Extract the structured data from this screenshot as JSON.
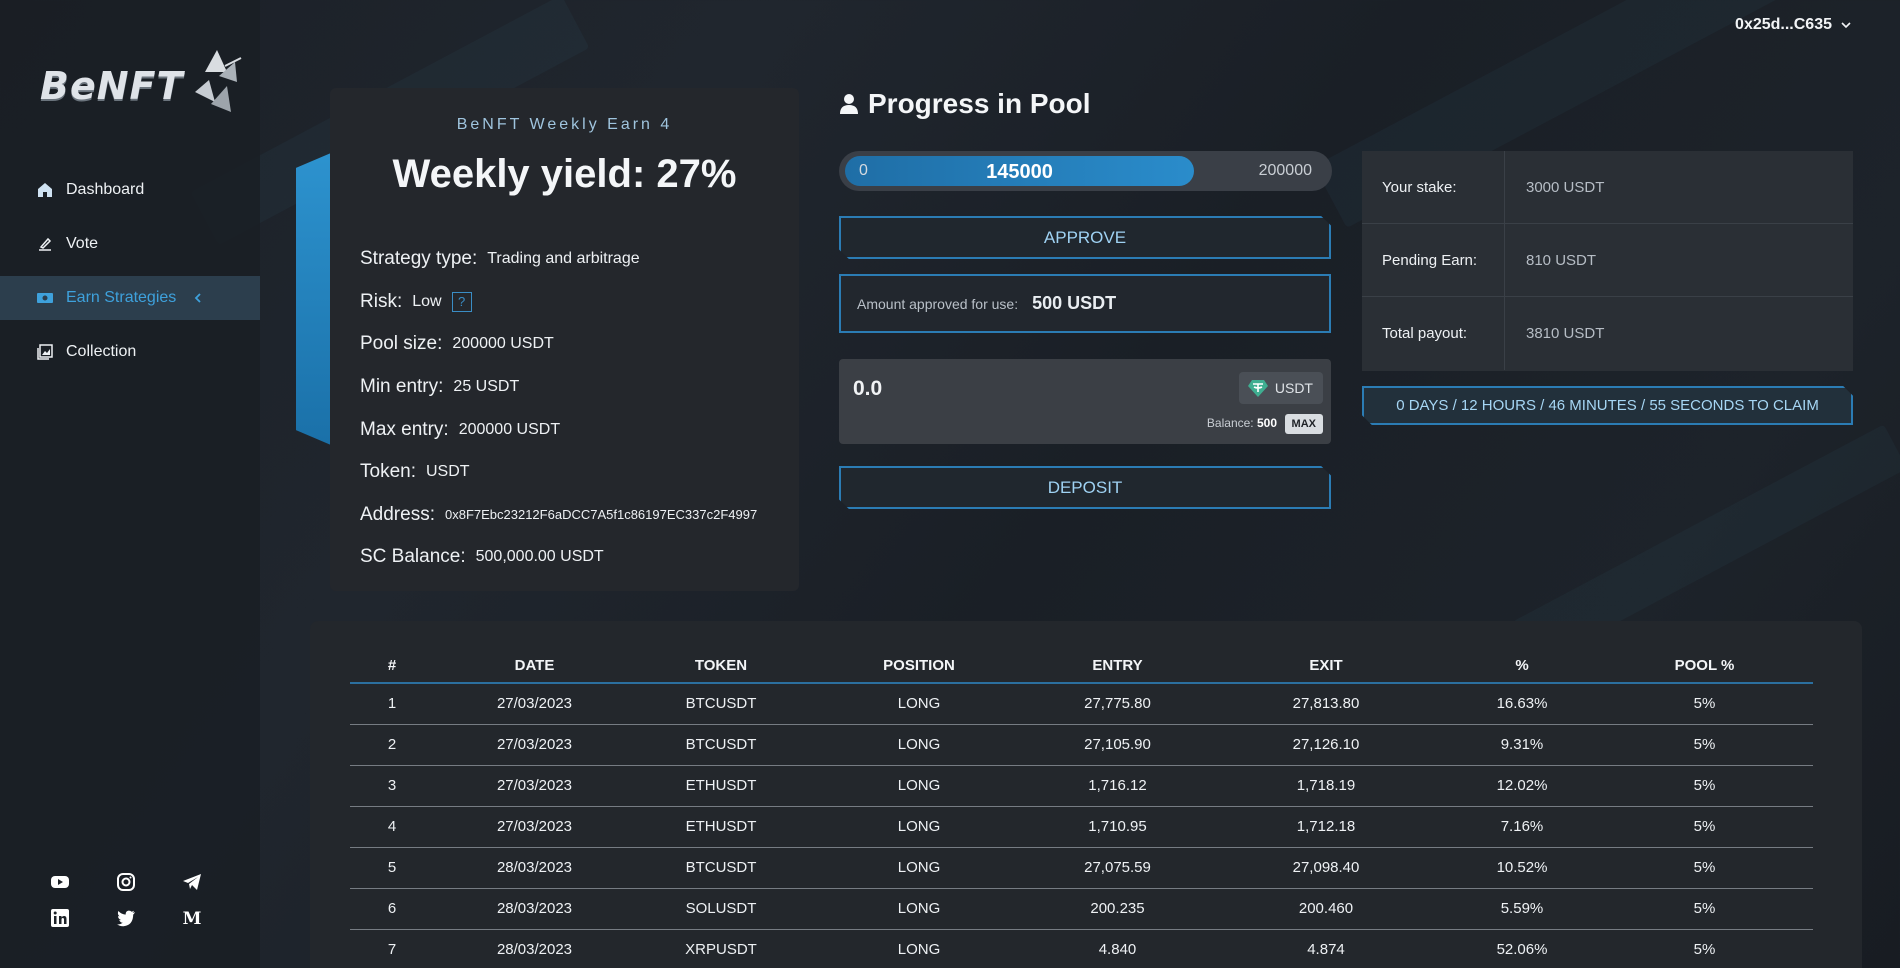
{
  "wallet": {
    "address": "0x25d...C635"
  },
  "brand": {
    "logo_text": "BeNFT"
  },
  "sidebar": {
    "items": [
      {
        "label": "Dashboard",
        "icon": "home-icon"
      },
      {
        "label": "Vote",
        "icon": "vote-icon"
      },
      {
        "label": "Earn Strategies",
        "icon": "money-icon",
        "active": true
      },
      {
        "label": "Collection",
        "icon": "collection-icon"
      }
    ],
    "socials": [
      "youtube-icon",
      "instagram-icon",
      "telegram-icon",
      "linkedin-icon",
      "twitter-icon",
      "medium-icon"
    ]
  },
  "strategy": {
    "subtitle": "BeNFT Weekly Earn 4",
    "title": "Weekly yield: 27%",
    "fields": [
      {
        "label": "Strategy type:",
        "value": "Trading and arbitrage"
      },
      {
        "label": "Risk:",
        "value": "Low",
        "help": "?"
      },
      {
        "label": "Pool size:",
        "value": "200000 USDT"
      },
      {
        "label": "Min entry:",
        "value": "25 USDT"
      },
      {
        "label": "Max entry:",
        "value": "200000 USDT"
      },
      {
        "label": "Token:",
        "value": "USDT"
      },
      {
        "label": "Address:",
        "value": "0x8F7Ebc23212F6aDCC7A5f1c86197EC337c2F4997"
      },
      {
        "label": "SC Balance:",
        "value": "500,000.00 USDT"
      }
    ]
  },
  "pool": {
    "title": "Progress in Pool",
    "min": "0",
    "current": "145000",
    "max": "200000",
    "fill_fraction": 0.725,
    "approve_label": "APPROVE",
    "approved_label": "Amount approved for use:",
    "approved_value": "500 USDT",
    "deposit_value": "0.0",
    "token": "USDT",
    "balance_label": "Balance:",
    "balance_value": "500",
    "max_label": "MAX",
    "deposit_label": "DEPOSIT"
  },
  "stake": {
    "rows": [
      {
        "label": "Your stake:",
        "value": "3000 USDT"
      },
      {
        "label": "Pending Earn:",
        "value": "810 USDT"
      },
      {
        "label": "Total payout:",
        "value": "3810 USDT"
      }
    ],
    "timer": "0 DAYS / 12 HOURS / 46 MINUTES / 55 SECONDS TO CLAIM"
  },
  "trades": {
    "columns": [
      "#",
      "DATE",
      "TOKEN",
      "POSITION",
      "ENTRY",
      "EXIT",
      "%",
      "POOL %"
    ],
    "rows": [
      [
        "1",
        "27/03/2023",
        "BTCUSDT",
        "LONG",
        "27,775.80",
        "27,813.80",
        "16.63%",
        "5%"
      ],
      [
        "2",
        "27/03/2023",
        "BTCUSDT",
        "LONG",
        "27,105.90",
        "27,126.10",
        "9.31%",
        "5%"
      ],
      [
        "3",
        "27/03/2023",
        "ETHUSDT",
        "LONG",
        "1,716.12",
        "1,718.19",
        "12.02%",
        "5%"
      ],
      [
        "4",
        "27/03/2023",
        "ETHUSDT",
        "LONG",
        "1,710.95",
        "1,712.18",
        "7.16%",
        "5%"
      ],
      [
        "5",
        "28/03/2023",
        "BTCUSDT",
        "LONG",
        "27,075.59",
        "27,098.40",
        "10.52%",
        "5%"
      ],
      [
        "6",
        "28/03/2023",
        "SOLUSDT",
        "LONG",
        "200.235",
        "200.460",
        "5.59%",
        "5%"
      ],
      [
        "7",
        "28/03/2023",
        "XRPUSDT",
        "LONG",
        "4.840",
        "4.874",
        "52.06%",
        "5%"
      ]
    ]
  },
  "colors": {
    "accent": "#2d93cf",
    "background": "#1b2027",
    "panel": "#24272c"
  }
}
